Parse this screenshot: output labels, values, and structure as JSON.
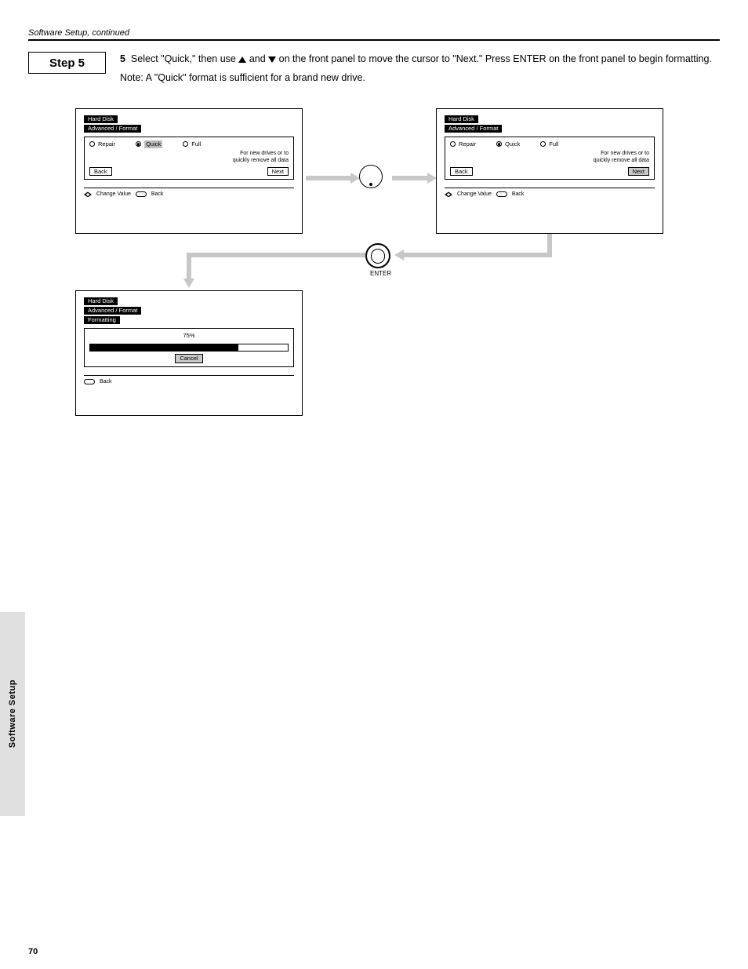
{
  "chapter": "Software Setup, continued",
  "rule": true,
  "step": {
    "label": "Step 5",
    "num": "5",
    "text_pre": "Select \"Quick,\" then use ",
    "text_mid": " and ",
    "text_post": " on the front panel to move the cursor to \"Next.\" Press ENTER on the front panel to begin formatting.",
    "note": "Note: A \"Quick\" format is sufficient for a brand new drive."
  },
  "panels": {
    "p1": {
      "tab1": "Hard Disk",
      "tab2": "Advanced / Format",
      "radios": {
        "r1": "Repair",
        "r2": "Quick",
        "r3": "Full"
      },
      "guide": "For new drives or to\nquickly remove all data",
      "back": "Back",
      "next": "Next",
      "foot": "Change Value            Back"
    },
    "p2": {
      "tab1": "Hard Disk",
      "tab2": "Advanced / Format",
      "radios": {
        "r1": "Repair",
        "r2": "Quick",
        "r3": "Full"
      },
      "guide": "For new drives or to\nquickly remove all data",
      "back": "Back",
      "next": "Next",
      "foot": "Change Value            Back"
    },
    "p3": {
      "tab1": "Hard Disk",
      "tab2": "Advanced / Format",
      "tab3": "Formatting",
      "pct": "75%",
      "cancel": "Cancel",
      "foot": "Back"
    }
  },
  "enter_label": "ENTER",
  "side_tab": "Software Setup",
  "page_num": "70"
}
